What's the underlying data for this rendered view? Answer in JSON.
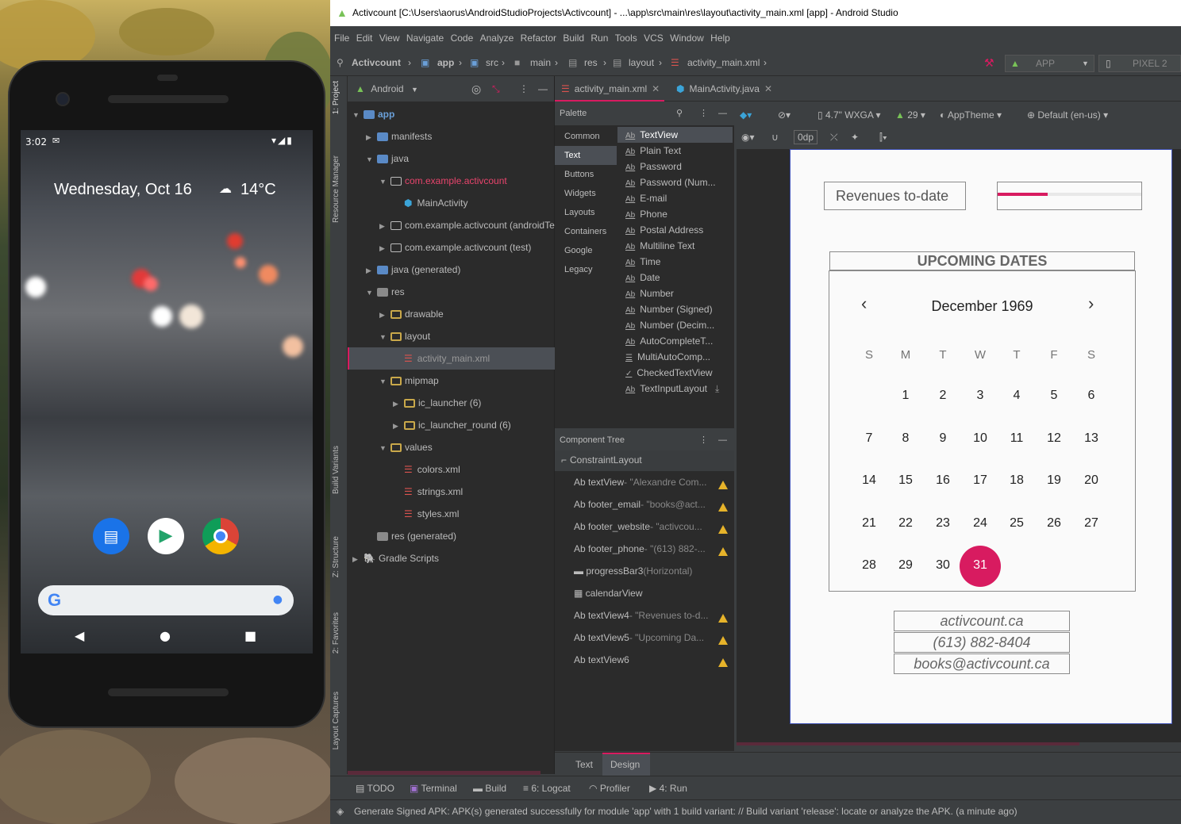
{
  "phone": {
    "time": "3:02",
    "date": "Wednesday, Oct 16",
    "temp": "14°C"
  },
  "ide": {
    "title": "Activcount [C:\\Users\\aorus\\AndroidStudioProjects\\Activcount] - ...\\app\\src\\main\\res\\layout\\activity_main.xml [app] - Android Studio",
    "menu": [
      "File",
      "Edit",
      "View",
      "Navigate",
      "Code",
      "Analyze",
      "Refactor",
      "Build",
      "Run",
      "Tools",
      "VCS",
      "Window",
      "Help"
    ],
    "breadcrumbs": [
      "Activcount",
      "app",
      "src",
      "main",
      "res",
      "layout",
      "activity_main.xml"
    ],
    "run_config": "APP",
    "device": "PIXEL 2",
    "side_tabs": {
      "project": "1: Project",
      "resource": "Resource Manager",
      "variants": "Build Variants",
      "structure": "Z: Structure",
      "favorites": "2: Favorites",
      "captures": "Layout Captures"
    },
    "project_view": "Android",
    "tree": [
      {
        "label": "app",
        "indent": 0
      },
      {
        "label": "manifests",
        "indent": 1
      },
      {
        "label": "java",
        "indent": 1
      },
      {
        "label": "com.example.activcount",
        "indent": 2
      },
      {
        "label": "MainActivity",
        "indent": 3
      },
      {
        "label": "com.example.activcount (androidTe",
        "indent": 2
      },
      {
        "label": "com.example.activcount (test)",
        "indent": 2
      },
      {
        "label": "java (generated)",
        "indent": 1
      },
      {
        "label": "res",
        "indent": 1
      },
      {
        "label": "drawable",
        "indent": 2
      },
      {
        "label": "layout",
        "indent": 2
      },
      {
        "label": "activity_main.xml",
        "indent": 3
      },
      {
        "label": "mipmap",
        "indent": 2
      },
      {
        "label": "ic_launcher (6)",
        "indent": 3
      },
      {
        "label": "ic_launcher_round (6)",
        "indent": 3
      },
      {
        "label": "values",
        "indent": 2
      },
      {
        "label": "colors.xml",
        "indent": 3
      },
      {
        "label": "strings.xml",
        "indent": 3
      },
      {
        "label": "styles.xml",
        "indent": 3
      },
      {
        "label": "res (generated)",
        "indent": 1
      },
      {
        "label": "Gradle Scripts",
        "indent": 0
      }
    ],
    "editor_tabs": [
      "activity_main.xml",
      "MainActivity.java"
    ],
    "palette_title": "Palette",
    "palette_categories": [
      "Common",
      "Text",
      "Buttons",
      "Widgets",
      "Layouts",
      "Containers",
      "Google",
      "Legacy"
    ],
    "palette_items": [
      "TextView",
      "Plain Text",
      "Password",
      "Password (Num...",
      "E-mail",
      "Phone",
      "Postal Address",
      "Multiline Text",
      "Time",
      "Date",
      "Number",
      "Number (Signed)",
      "Number (Decim...",
      "AutoCompleteT...",
      "MultiAutoComp...",
      "CheckedTextView",
      "TextInputLayout"
    ],
    "component_tree_title": "Component Tree",
    "components": [
      {
        "name": "ConstraintLayout",
        "detail": ""
      },
      {
        "name": "textView",
        "detail": "- \"Alexandre Com..."
      },
      {
        "name": "footer_email",
        "detail": "- \"books@act..."
      },
      {
        "name": "footer_website",
        "detail": "- \"activcou..."
      },
      {
        "name": "footer_phone",
        "detail": "- \"(613) 882-..."
      },
      {
        "name": "progressBar3",
        "detail": "(Horizontal)"
      },
      {
        "name": "calendarView",
        "detail": ""
      },
      {
        "name": "textView4",
        "detail": "- \"Revenues to-d..."
      },
      {
        "name": "textView5",
        "detail": "- \"Upcoming Da..."
      },
      {
        "name": "textView6",
        "detail": ""
      }
    ],
    "design_toolbar": {
      "device": "4.7\" WXGA",
      "api": "29",
      "theme": "AppTheme",
      "locale": "Default (en-us)",
      "margin": "0dp"
    },
    "bottom_tabs": [
      "Text",
      "Design"
    ],
    "tool_windows": [
      "TODO",
      "Terminal",
      "Build",
      "6: Logcat",
      "Profiler",
      "4: Run"
    ],
    "status": "Generate Signed APK: APK(s) generated successfully for module 'app' with 1 build variant: // Build variant 'release': locate or analyze the APK. (a minute ago)"
  },
  "app": {
    "revenues_label": "Revenues to-date",
    "progress": 0.35,
    "upcoming": "UPCOMING DATES",
    "month": "December 1969",
    "weekdays": [
      "S",
      "M",
      "T",
      "W",
      "T",
      "F",
      "S"
    ],
    "weeks": [
      [
        "",
        "1",
        "2",
        "3",
        "4",
        "5",
        "6"
      ],
      [
        "7",
        "8",
        "9",
        "10",
        "11",
        "12",
        "13"
      ],
      [
        "14",
        "15",
        "16",
        "17",
        "18",
        "19",
        "20"
      ],
      [
        "21",
        "22",
        "23",
        "24",
        "25",
        "26",
        "27"
      ],
      [
        "28",
        "29",
        "30",
        "31",
        "",
        "",
        ""
      ]
    ],
    "selected": "31",
    "website": "activcount.ca",
    "phone": "(613) 882-8404",
    "email": "books@activcount.ca"
  },
  "colors": {
    "accent": "#d81b60",
    "folder": "#c9a84a",
    "selected_bg": "#4b4f55"
  }
}
